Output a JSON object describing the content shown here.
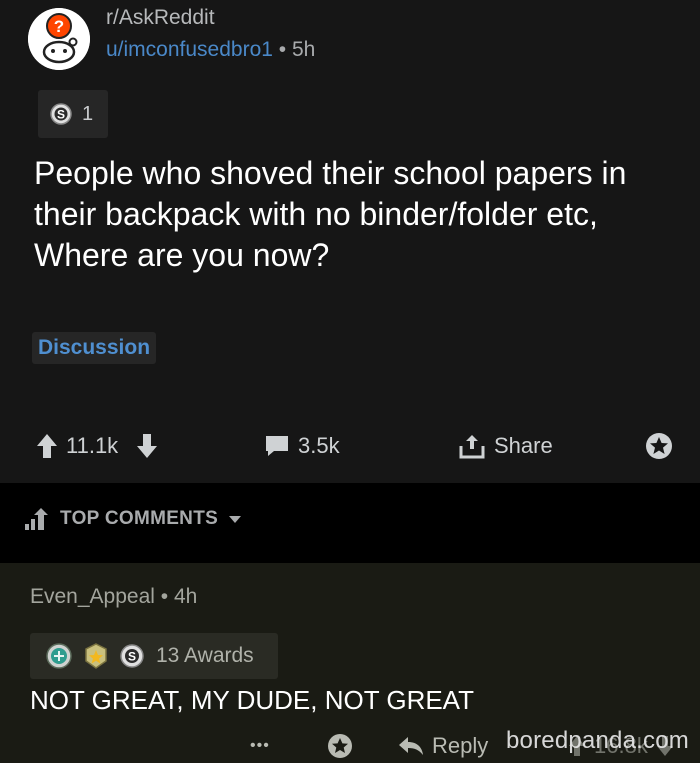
{
  "post": {
    "subreddit": "r/AskReddit",
    "author": "u/imconfusedbro1",
    "separator": "•",
    "age": "5h",
    "award_count": "1",
    "title": "People who shoved their school papers in their backpack with no binder/folder etc, Where are you now?",
    "flair": "Discussion",
    "upvotes": "11.1k",
    "comments": "3.5k",
    "share_label": "Share"
  },
  "sort_bar": {
    "label": "TOP COMMENTS"
  },
  "comment": {
    "author": "Even_Appeal",
    "separator": "•",
    "age": "4h",
    "awards_label": "13 Awards",
    "body": "NOT GREAT, MY DUDE, NOT GREAT",
    "more": "•••",
    "reply_label": "Reply",
    "score": "16.8k"
  },
  "watermark": "boredpanda.com",
  "colors": {
    "background": "#161616",
    "sort_bar": "#000000",
    "comment_bg": "#1a1b14",
    "link_blue": "#4a88c8",
    "text_white": "#ffffff"
  }
}
